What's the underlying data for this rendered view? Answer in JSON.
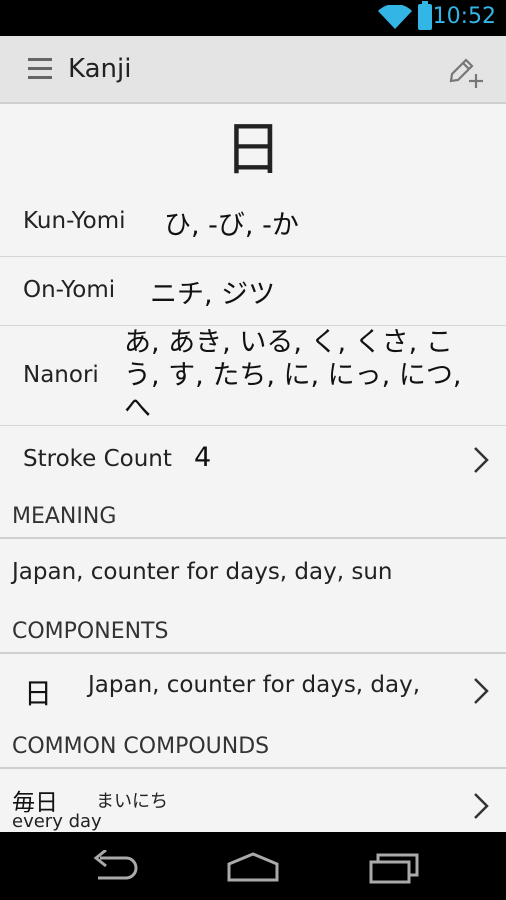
{
  "status_bar": {
    "time": "10:52",
    "wifi_icon": "wifi-icon",
    "battery_icon": "battery-icon",
    "accent_color": "#33b5e5"
  },
  "action_bar": {
    "title": "Kanji",
    "menu_icon": "menu-icon",
    "edit_icon": "pencil-add-icon"
  },
  "kanji": {
    "character": "日",
    "kun_yomi": {
      "label": "Kun-Yomi",
      "value": "ひ, -び, -か"
    },
    "on_yomi": {
      "label": "On-Yomi",
      "value": "ニチ, ジツ"
    },
    "nanori": {
      "label": "Nanori",
      "lines": [
        "あ, あき, いる, く, くさ, こ",
        "う, す, たち, に, にっ, につ,",
        "へ"
      ]
    },
    "stroke_count": {
      "label": "Stroke Count",
      "value": "4"
    }
  },
  "meaning": {
    "header": "MEANING",
    "text": "Japan, counter for days, day, sun"
  },
  "components": {
    "header": "COMPONENTS",
    "items": [
      {
        "character": "日",
        "meaning": "Japan, counter for days, day,"
      }
    ]
  },
  "compounds": {
    "header": "COMMON COMPOUNDS",
    "items": [
      {
        "word": "毎日",
        "reading": "まいにち",
        "meaning": "every day"
      }
    ]
  },
  "nav_bar": {
    "back_icon": "back-icon",
    "home_icon": "home-icon",
    "recents_icon": "recent-apps-icon"
  }
}
